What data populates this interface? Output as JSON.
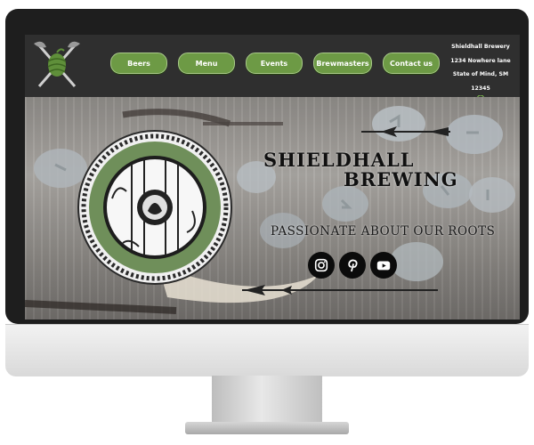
{
  "site": {
    "brand_line1": "SHIELDHALL",
    "brand_line2": "BREWING",
    "tagline": "PASSIONATE ABOUT OUR ROOTS"
  },
  "nav": {
    "items": [
      {
        "label": "Beers"
      },
      {
        "label": "Menu"
      },
      {
        "label": "Events"
      },
      {
        "label": "Brewmasters"
      },
      {
        "label": "Contact us"
      }
    ]
  },
  "address": {
    "name": "Shieldhall Brewery",
    "street": "1234 Nowhere lane",
    "city": "State of Mind, SM 12345"
  },
  "social": [
    "instagram-icon",
    "pinterest-icon",
    "youtube-icon"
  ],
  "colors": {
    "nav_button": "#6d9a45",
    "header_bg": "#2f2f2f",
    "monitor_bezel": "#1e1e1e",
    "shield_ring": "#6f8f5a"
  }
}
